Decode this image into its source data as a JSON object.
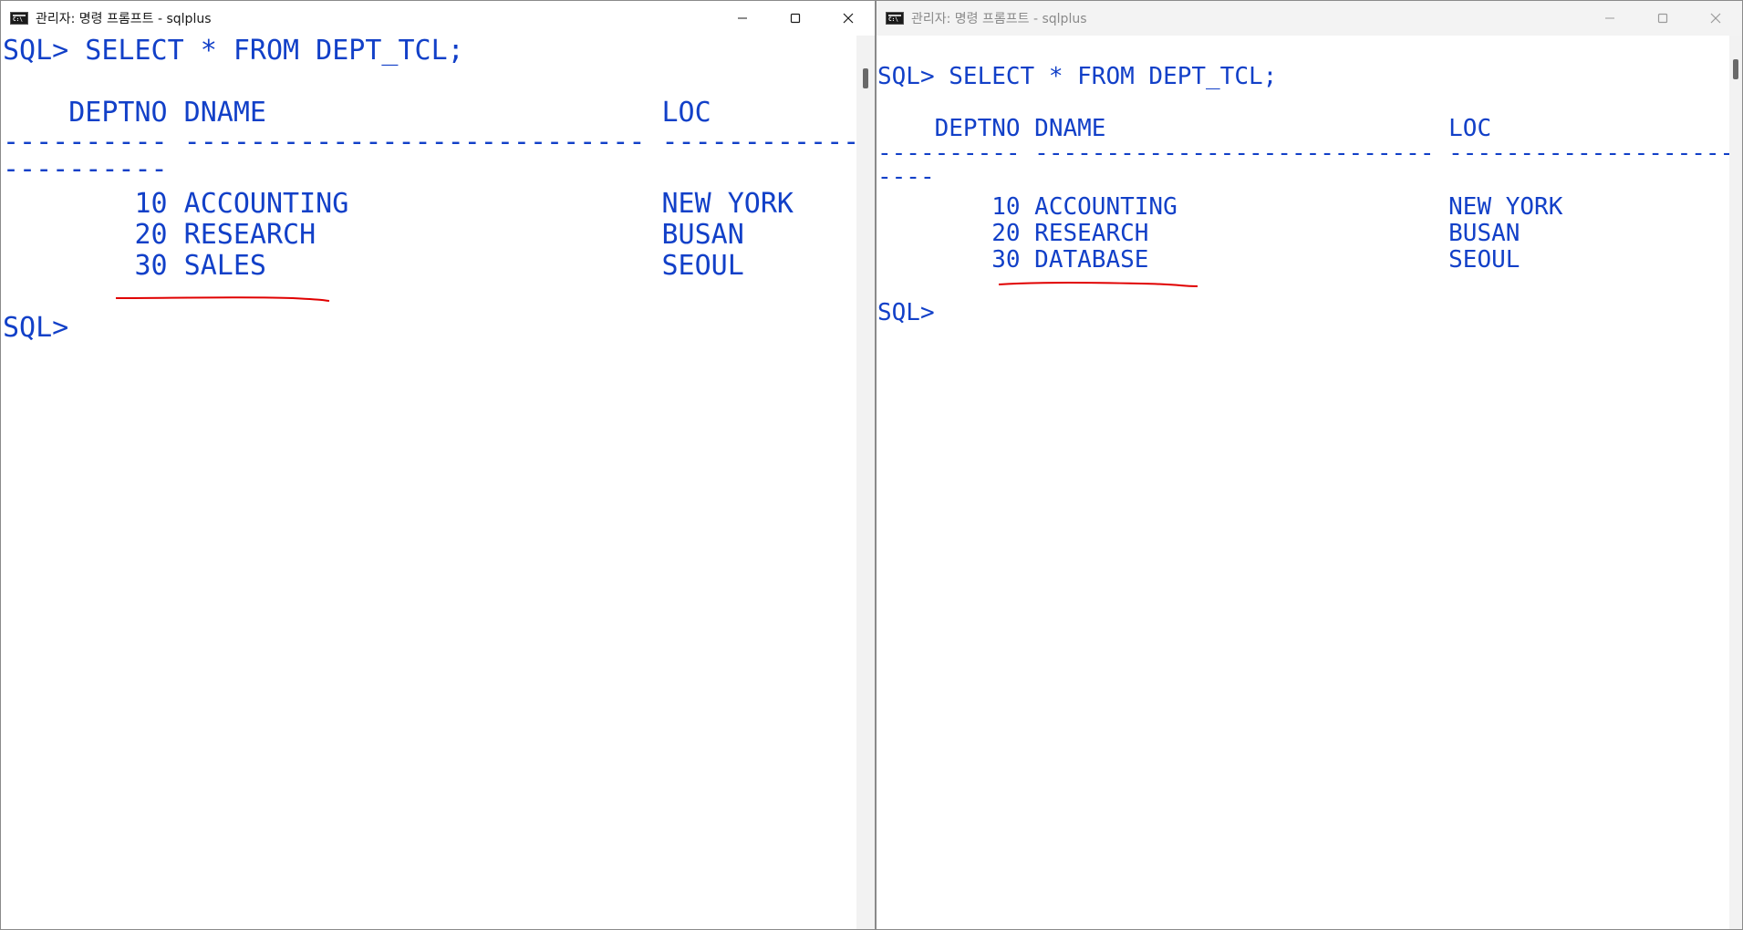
{
  "left_window": {
    "title": "관리자: 명령 프롬프트 - sqlplus",
    "lines": [
      "SQL> SELECT * FROM DEPT_TCL;",
      "",
      "    DEPTNO DNAME                        LOC",
      "---------- ---------------------------- ---------------------------",
      "----------",
      "        10 ACCOUNTING                   NEW YORK",
      "        20 RESEARCH                     BUSAN",
      "        30 SALES                        SEOUL",
      "",
      "SQL>"
    ]
  },
  "right_window": {
    "title": "관리자: 명령 프롬프트 - sqlplus",
    "lines": [
      "SQL> SELECT * FROM DEPT_TCL;",
      "",
      "    DEPTNO DNAME                        LOC",
      "---------- ---------------------------- ---------------------------",
      "----",
      "        10 ACCOUNTING                   NEW YORK",
      "        20 RESEARCH                     BUSAN",
      "        30 DATABASE                     SEOUL",
      "",
      "SQL>"
    ]
  },
  "colors": {
    "console_text": "#1240c8",
    "annotation": "#e00000"
  },
  "icons": {
    "app": "console-app-icon",
    "minimize": "minimize-icon",
    "maximize": "maximize-icon",
    "close": "close-icon"
  }
}
